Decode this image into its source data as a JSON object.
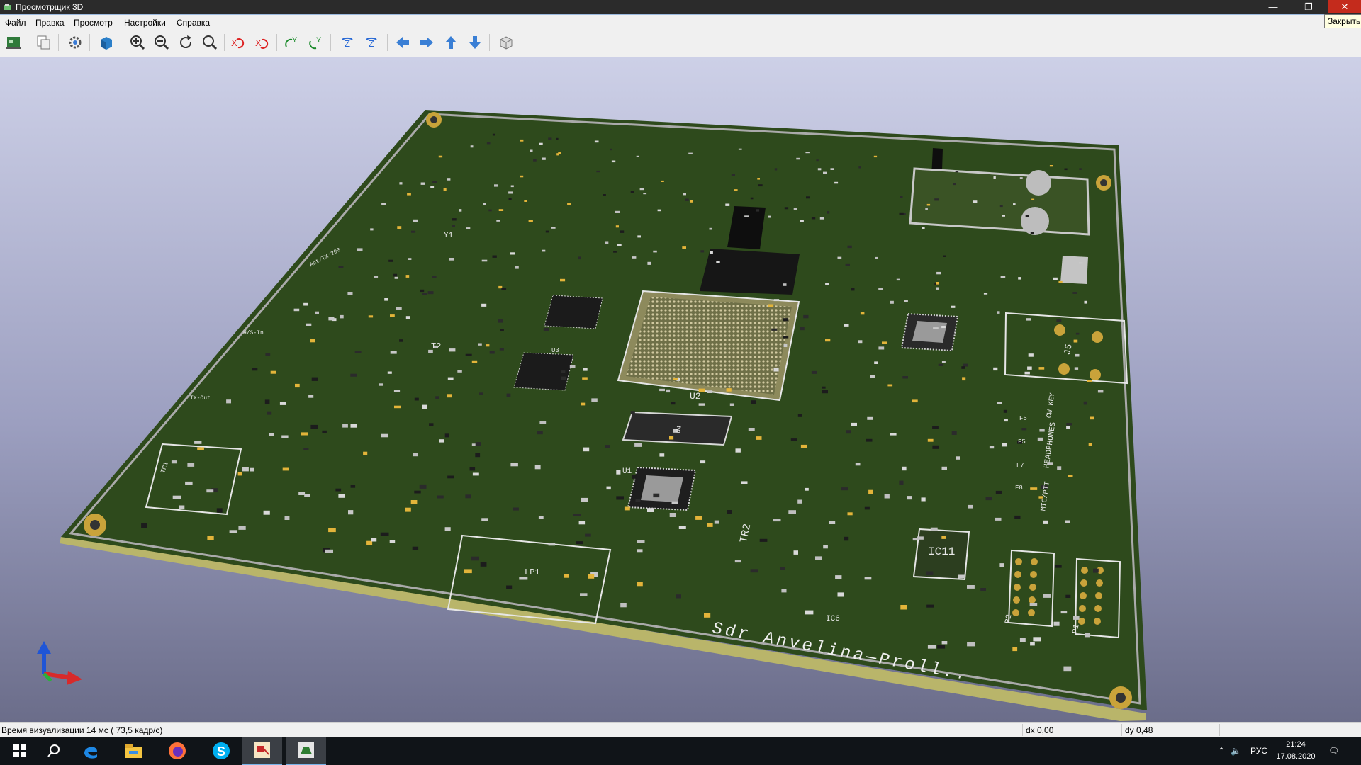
{
  "window": {
    "title": "Просмотрщик 3D",
    "close_tooltip": "Закрыть"
  },
  "menu": [
    "Файл",
    "Правка",
    "Просмотр",
    "Настройки",
    "Справка"
  ],
  "toolbar": {
    "icons": [
      "reload-board-icon",
      "copy-image-icon",
      "settings-icon",
      "render-mode-icon",
      "zoom-in-icon",
      "zoom-out-icon",
      "redraw-icon",
      "zoom-fit-icon",
      "rotate-x-cw-icon",
      "rotate-x-ccw-icon",
      "rotate-y-cw-icon",
      "rotate-y-ccw-icon",
      "rotate-z-cw-icon",
      "rotate-z-ccw-icon",
      "pan-left-icon",
      "pan-right-icon",
      "pan-up-icon",
      "pan-down-icon",
      "toggle-orthographic-icon"
    ]
  },
  "board": {
    "silkscreen_title": "Sdr  Anvelina—Proll..",
    "designators": [
      "U2",
      "U1",
      "IC11",
      "TR2",
      "LP1",
      "J5",
      "P2",
      "P1",
      "Y1",
      "T2",
      "TR1",
      "U4",
      "IC6",
      "F6",
      "F5",
      "F7",
      "F8",
      "U3"
    ],
    "connector_labels": [
      "HEADPHONES",
      "CW KEY",
      "MIC/PTT",
      "TX-Out",
      "H/S-In",
      "Ant/TX:200"
    ]
  },
  "status": {
    "render_time": "Время визуализации 14 мс ( 73,5 кадр/с)",
    "dx": "dx 0,00",
    "dy": "dy 0,48"
  },
  "taskbar": {
    "apps": [
      "start-icon",
      "search-icon",
      "edge-icon",
      "explorer-icon",
      "firefox-icon",
      "skype-icon",
      "kicad-pcbnew-icon",
      "kicad-3d-viewer-icon"
    ],
    "lang": "РУС",
    "time": "21:24",
    "date": "17.08.2020"
  }
}
